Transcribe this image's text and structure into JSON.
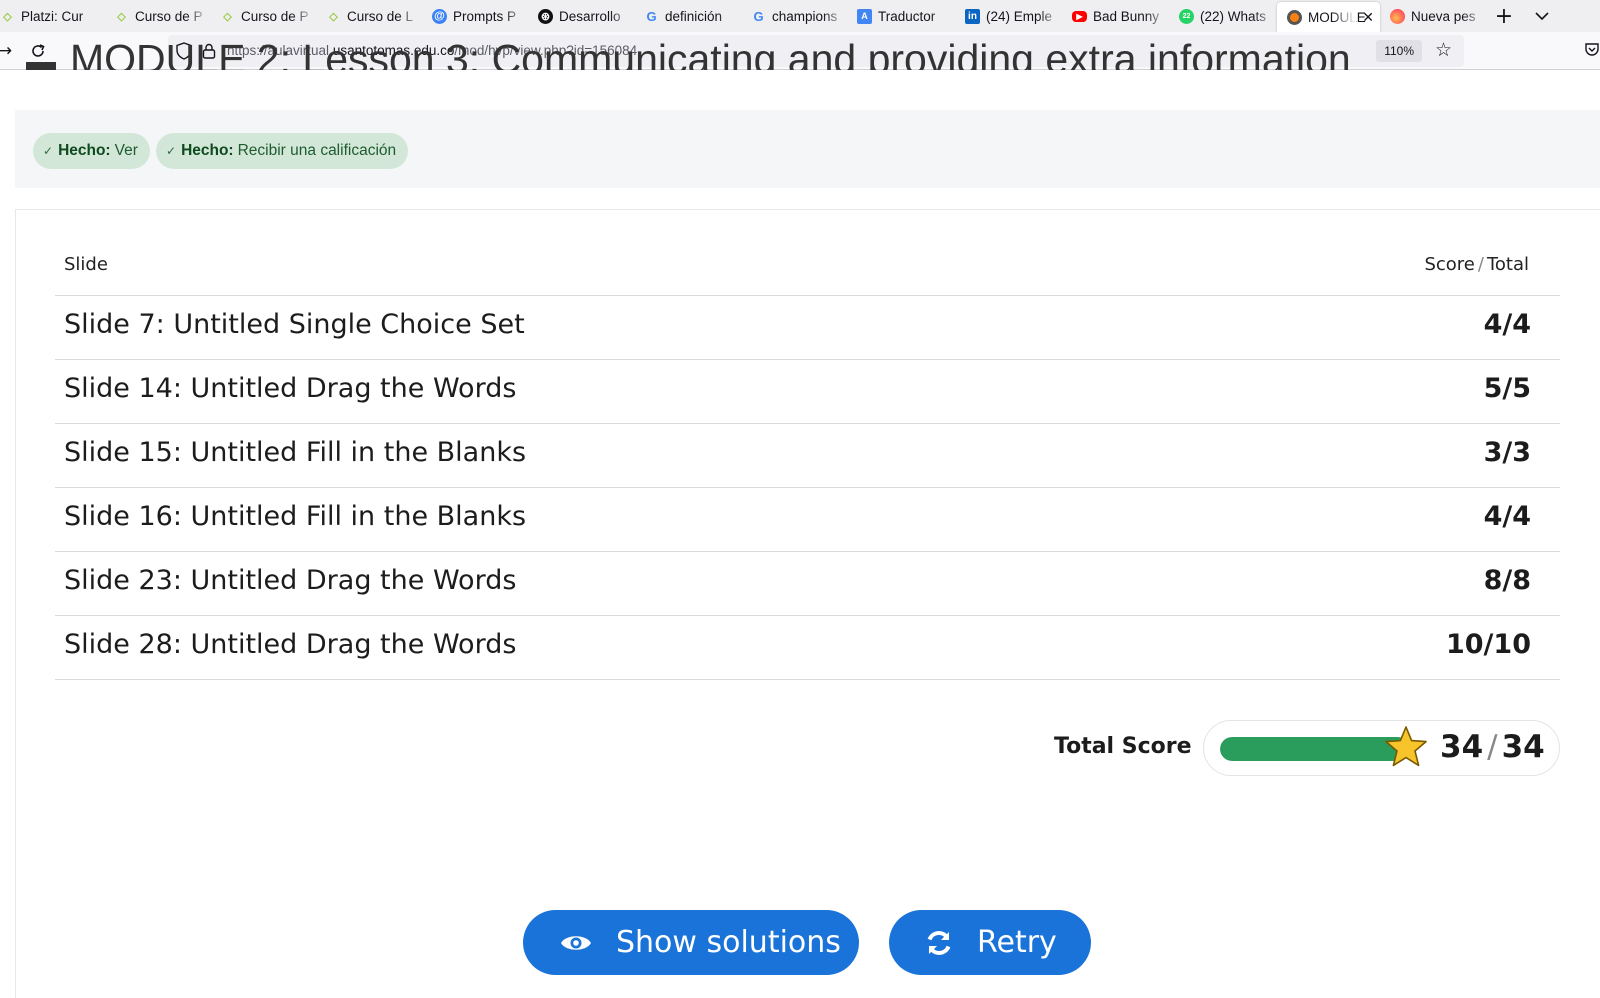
{
  "browser": {
    "tabs": [
      {
        "label": "Platzi: Cur",
        "icon": "platzi-icon",
        "color": "#98ca3f"
      },
      {
        "label": "Curso de P",
        "icon": "platzi-icon",
        "color": "#98ca3f"
      },
      {
        "label": "Curso de P",
        "icon": "platzi-icon",
        "color": "#98ca3f"
      },
      {
        "label": "Curso de L",
        "icon": "platzi-icon",
        "color": "#98ca3f"
      },
      {
        "label": "Prompts P",
        "icon": "prompts-icon",
        "color": "#3b82f6"
      },
      {
        "label": "Desarrollo",
        "icon": "openai-icon",
        "color": "#000000"
      },
      {
        "label": "definición",
        "icon": "google-icon",
        "color": "#4285f4"
      },
      {
        "label": "champions",
        "icon": "google-icon",
        "color": "#4285f4"
      },
      {
        "label": "Traductor",
        "icon": "translate-icon",
        "color": "#4285f4"
      },
      {
        "label": "(24) Emple",
        "icon": "linkedin-icon",
        "color": "#0a66c2"
      },
      {
        "label": "Bad Bunny",
        "icon": "youtube-icon",
        "color": "#ff0000"
      },
      {
        "label": "(22) Whats",
        "icon": "whatsapp-icon",
        "color": "#25d366"
      },
      {
        "label": "MODULE",
        "icon": "moodle-icon",
        "color": "#f98012",
        "active": true
      },
      {
        "label": "Nueva pes",
        "icon": "firefox-icon",
        "color": "#ff7139"
      }
    ],
    "url_prefix": "https://aulavirtual.",
    "url_host": "usantotomas.edu.co",
    "url_path": "/mod/hvp/view.php?id=156084",
    "zoom": "110%"
  },
  "page": {
    "title": "MODULE 2: Lesson 3: Communicating and providing extra information",
    "completion": [
      {
        "label": "Hecho:",
        "value": "Ver"
      },
      {
        "label": "Hecho:",
        "value": "Recibir una calificación"
      }
    ]
  },
  "results": {
    "col_slide": "Slide",
    "col_score": "Score",
    "col_sep": "/",
    "col_total": "Total",
    "rows": [
      {
        "name": "Slide 7: Untitled Single Choice Set",
        "score": "4/4"
      },
      {
        "name": "Slide 14: Untitled Drag the Words",
        "score": "5/5"
      },
      {
        "name": "Slide 15: Untitled Fill in the Blanks",
        "score": "3/3"
      },
      {
        "name": "Slide 16: Untitled Fill in the Blanks",
        "score": "4/4"
      },
      {
        "name": "Slide 23: Untitled Drag the Words",
        "score": "8/8"
      },
      {
        "name": "Slide 28: Untitled Drag the Words",
        "score": "10/10"
      }
    ],
    "total_label": "Total Score",
    "total_score": "34",
    "total_sep": "/",
    "total_max": "34",
    "progress": 1.0
  },
  "actions": {
    "show_solutions": "Show solutions",
    "retry": "Retry"
  },
  "colors": {
    "primary": "#1a73d9",
    "progress": "#2a9d5c",
    "badge_bg": "#d2e7d8",
    "star": "#f7c52b"
  }
}
